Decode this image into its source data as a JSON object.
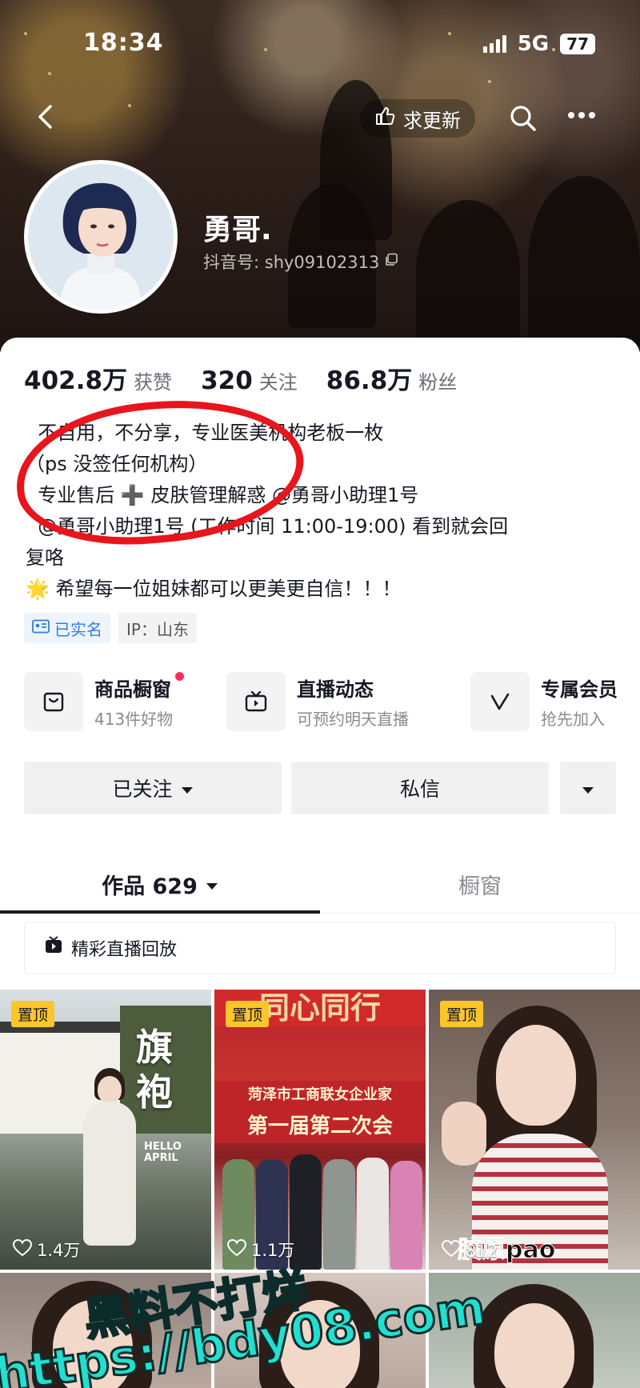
{
  "status_bar": {
    "time": "18:34",
    "network": "5G",
    "battery": "77"
  },
  "nav": {
    "update_label": "求更新"
  },
  "profile": {
    "name": "勇哥.",
    "id_label": "抖音号: shy09102313"
  },
  "stats": [
    {
      "value": "402.8万",
      "label": "获赞"
    },
    {
      "value": "320",
      "label": "关注"
    },
    {
      "value": "86.8万",
      "label": "粉丝"
    }
  ],
  "bio": {
    "lines": [
      "  不自用，不分享，专业医美机构老板一枚",
      "（ps 没签任何机构）",
      "  专业售后 ➕ 皮肤管理解惑 @勇哥小助理1号",
      "  @勇哥小助理1号 (工作时间 11:00-19:00) 看到就会回",
      "复咯",
      "🌟 希望每一位姐妹都可以更美更自信！！！"
    ]
  },
  "tags": {
    "verified": "已实名",
    "ip": "IP：山东"
  },
  "services": [
    {
      "title": "商品橱窗",
      "sub": "413件好物",
      "icon": "bag-icon"
    },
    {
      "title": "直播动态",
      "sub": "可预约明天直播",
      "icon": "tv-icon"
    },
    {
      "title": "专属会员",
      "sub": "抢先加入",
      "icon": "v-icon"
    }
  ],
  "actions": {
    "follow": "已关注",
    "message": "私信"
  },
  "tabs": {
    "works": "作品 629",
    "showcase": "橱窗"
  },
  "replay_label": "精彩直播回放",
  "videos": [
    {
      "pin": "置顶",
      "likes": "1.4万",
      "overlay": "旗\n袍",
      "small_text": "HELLO\nAPRIL"
    },
    {
      "pin": "置顶",
      "likes": "1.1万",
      "banner_top": "同心同行",
      "banner_a": "菏泽市工商联女企业家",
      "banner_b": "第一届第二次会"
    },
    {
      "pin": "置顶",
      "likes": "812",
      "caption": "胶原pao"
    }
  ],
  "watermark": {
    "line1": "黑料不打烊",
    "line2": "https://bdy08.com"
  },
  "colors": {
    "accent_red": "#fe2c55",
    "pin_yellow": "#fcc52c",
    "mark_red": "#e8151c",
    "watermark": "#22e0d0"
  }
}
